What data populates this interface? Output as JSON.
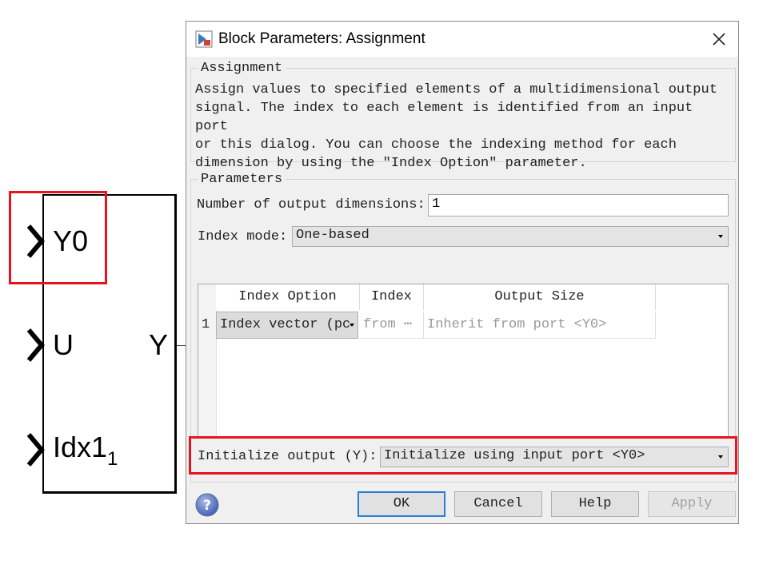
{
  "block": {
    "ports_in": [
      "Y0",
      "U",
      "Idx1"
    ],
    "idx_sub": "1",
    "port_out": "Y"
  },
  "dialog": {
    "title": "Block Parameters: Assignment",
    "description_group": "Assignment",
    "description": "Assign values to specified elements of a multidimensional output\nsignal. The index to each element is identified from an input port\nor this dialog. You can choose the indexing method for each\ndimension by using the \"Index Option\" parameter.",
    "parameters_group": "Parameters",
    "num_dims_label": "Number of output dimensions:",
    "num_dims_value": "1",
    "index_mode_label": "Index mode:",
    "index_mode_value": "One-based",
    "table": {
      "headers": [
        "Index Option",
        "Index",
        "Output Size"
      ],
      "rows": [
        {
          "num": "1",
          "index_option": "Index vector (pc",
          "index": "from ⋯",
          "output_size": "Inherit from port <Y0>"
        }
      ]
    },
    "init_output_label": "Initialize output (Y):",
    "init_output_value": "Initialize using input port <Y0>",
    "buttons": {
      "ok": "OK",
      "cancel": "Cancel",
      "help": "Help",
      "apply": "Apply"
    }
  },
  "colors": {
    "highlight": "#e8141d",
    "default_button_border": "#2a7fd4"
  }
}
